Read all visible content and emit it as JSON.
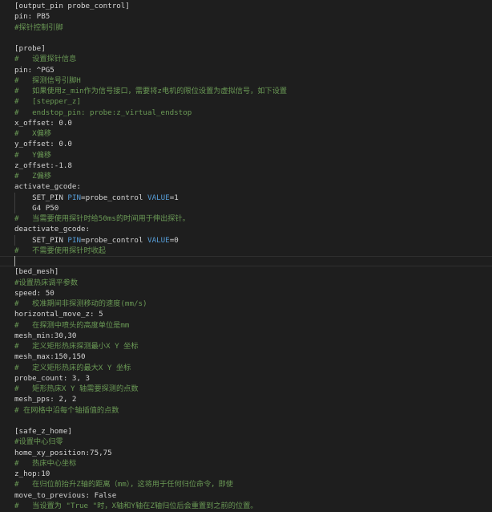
{
  "lines": [
    {
      "n": 1,
      "kind": "header",
      "text": "[output_pin probe_control]"
    },
    {
      "n": 2,
      "kind": "plain",
      "text": "pin: PB5"
    },
    {
      "n": 3,
      "kind": "comment",
      "text": "#探针控制引脚"
    },
    {
      "n": 4,
      "kind": "empty",
      "text": ""
    },
    {
      "n": 5,
      "kind": "header",
      "text": "[probe]"
    },
    {
      "n": 6,
      "kind": "comment",
      "text": "#   设置探针信息"
    },
    {
      "n": 7,
      "kind": "plain",
      "text": "pin: ^PG5"
    },
    {
      "n": 8,
      "kind": "comment",
      "text": "#   探测信号引脚H"
    },
    {
      "n": 9,
      "kind": "comment",
      "text": "#   如果使用z_min作为信号接口，需要将z电机的限位设置为虚拟信号，如下设置"
    },
    {
      "n": 10,
      "kind": "comment",
      "text": "#   [stepper_z]"
    },
    {
      "n": 11,
      "kind": "comment",
      "text": "#   endstop_pin: probe:z_virtual_endstop"
    },
    {
      "n": 12,
      "kind": "plain",
      "text": "x_offset: 0.0"
    },
    {
      "n": 13,
      "kind": "comment",
      "text": "#   X偏移"
    },
    {
      "n": 14,
      "kind": "plain",
      "text": "y_offset: 0.0"
    },
    {
      "n": 15,
      "kind": "comment",
      "text": "#   Y偏移"
    },
    {
      "n": 16,
      "kind": "plain",
      "text": "z_offset:-1.8"
    },
    {
      "n": 17,
      "kind": "comment",
      "text": "#   Z偏移"
    },
    {
      "n": 18,
      "kind": "plain",
      "text": "activate_gcode:"
    },
    {
      "n": 19,
      "kind": "gcode",
      "cmd": "SET_PIN",
      "p1": "PIN",
      "v1": "probe_control",
      "p2": "VALUE",
      "v2": "1"
    },
    {
      "n": 20,
      "kind": "indent",
      "text": "G4 P50"
    },
    {
      "n": 21,
      "kind": "comment",
      "text": "#   当需要使用探针时给50ms的时间用于伸出探针。"
    },
    {
      "n": 22,
      "kind": "plain",
      "text": "deactivate_gcode:"
    },
    {
      "n": 23,
      "kind": "gcode",
      "cmd": "SET_PIN",
      "p1": "PIN",
      "v1": "probe_control",
      "p2": "VALUE",
      "v2": "0"
    },
    {
      "n": 24,
      "kind": "comment",
      "text": "#   不需要使用探针时收起"
    },
    {
      "n": 25,
      "kind": "cursor",
      "text": ""
    },
    {
      "n": 26,
      "kind": "header",
      "text": "[bed_mesh]"
    },
    {
      "n": 27,
      "kind": "comment",
      "text": "#设置热床调平参数"
    },
    {
      "n": 28,
      "kind": "plain",
      "text": "speed: 50"
    },
    {
      "n": 29,
      "kind": "comment",
      "text": "#   校准期间非探测移动的速度(mm/s)"
    },
    {
      "n": 30,
      "kind": "plain",
      "text": "horizontal_move_z: 5"
    },
    {
      "n": 31,
      "kind": "comment",
      "text": "#   在探测中喷头的高度单位是mm"
    },
    {
      "n": 32,
      "kind": "plain",
      "text": "mesh_min:30,30"
    },
    {
      "n": 33,
      "kind": "comment",
      "text": "#   定义矩形热床探测最小X Y 坐标"
    },
    {
      "n": 34,
      "kind": "plain",
      "text": "mesh_max:150,150"
    },
    {
      "n": 35,
      "kind": "comment",
      "text": "#   定义矩形热床的最大X Y 坐标"
    },
    {
      "n": 36,
      "kind": "plain",
      "text": "probe_count: 3, 3"
    },
    {
      "n": 37,
      "kind": "comment",
      "text": "#   矩形热床X Y 轴需要探测的点数"
    },
    {
      "n": 38,
      "kind": "plain",
      "text": "mesh_pps: 2, 2"
    },
    {
      "n": 39,
      "kind": "comment",
      "text": "# 在网格中沿每个轴插值的点数"
    },
    {
      "n": 40,
      "kind": "empty",
      "text": ""
    },
    {
      "n": 41,
      "kind": "header",
      "text": "[safe_z_home]"
    },
    {
      "n": 42,
      "kind": "comment",
      "text": "#设置中心归零"
    },
    {
      "n": 43,
      "kind": "plain",
      "text": "home_xy_position:75,75"
    },
    {
      "n": 44,
      "kind": "comment",
      "text": "#   热床中心坐标"
    },
    {
      "n": 45,
      "kind": "plain",
      "text": "z_hop:10"
    },
    {
      "n": 46,
      "kind": "comment",
      "text": "#   在归位前抬升Z轴的距离（mm），这将用于任何归位命令，即使"
    },
    {
      "n": 47,
      "kind": "plain",
      "text": "move_to_previous: False"
    },
    {
      "n": 48,
      "kind": "comment",
      "text": "#   当设置为 \"True \"时，X轴和Y轴在Z轴归位后会重置到之前的位置。"
    }
  ],
  "colors": {
    "background": "#1e1e1e",
    "text": "#d4d4d4",
    "comment": "#6a9955",
    "param": "#569cd6"
  }
}
